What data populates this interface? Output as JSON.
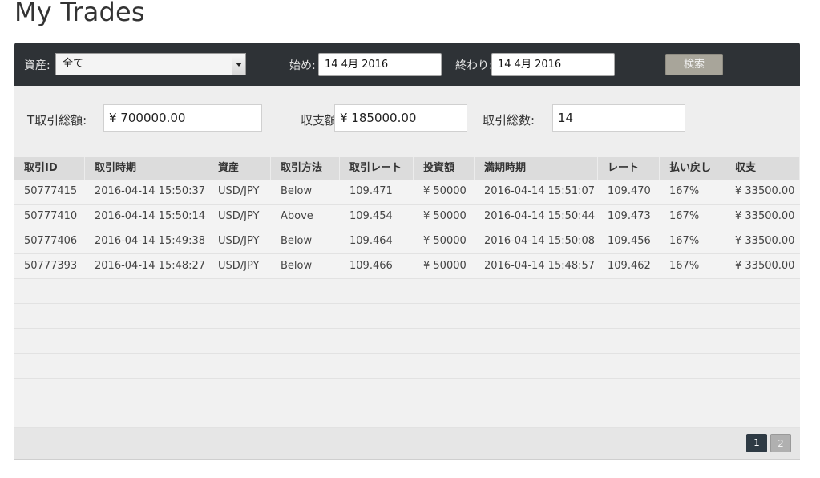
{
  "page": {
    "title": "My Trades"
  },
  "filters": {
    "asset_label": "資産:",
    "asset_value": "全て",
    "start_label": "始め:",
    "start_value": "14 4月 2016",
    "end_label": "終わり:",
    "end_value": "14 4月 2016",
    "search_label": "検索"
  },
  "summary": {
    "total_trade_label": "T取引総額:",
    "total_trade_value": "¥ 700000.00",
    "balance_label": "収支額:",
    "balance_value": "¥ 185000.00",
    "count_label": "取引総数:",
    "count_value": "14"
  },
  "table": {
    "columns": [
      "取引ID",
      "取引時期",
      "資産",
      "取引方法",
      "取引レート",
      "投資額",
      "満期時期",
      "レート",
      "払い戻し",
      "収支"
    ],
    "rows": [
      [
        "50777415",
        "2016-04-14 15:50:37",
        "USD/JPY",
        "Below",
        "109.471",
        "¥ 50000",
        "2016-04-14 15:51:07",
        "109.470",
        "167%",
        "¥ 33500.00"
      ],
      [
        "50777410",
        "2016-04-14 15:50:14",
        "USD/JPY",
        "Above",
        "109.454",
        "¥ 50000",
        "2016-04-14 15:50:44",
        "109.473",
        "167%",
        "¥ 33500.00"
      ],
      [
        "50777406",
        "2016-04-14 15:49:38",
        "USD/JPY",
        "Below",
        "109.464",
        "¥ 50000",
        "2016-04-14 15:50:08",
        "109.456",
        "167%",
        "¥ 33500.00"
      ],
      [
        "50777393",
        "2016-04-14 15:48:27",
        "USD/JPY",
        "Below",
        "109.466",
        "¥ 50000",
        "2016-04-14 15:48:57",
        "109.462",
        "167%",
        "¥ 33500.00"
      ]
    ],
    "empty_rows": 6
  },
  "pagination": {
    "pages": [
      "1",
      "2"
    ],
    "current": "1"
  },
  "colors": {
    "filter_bar": "#2e3236",
    "summary_bg": "#eeeeee",
    "active_page": "#2e3a44"
  }
}
